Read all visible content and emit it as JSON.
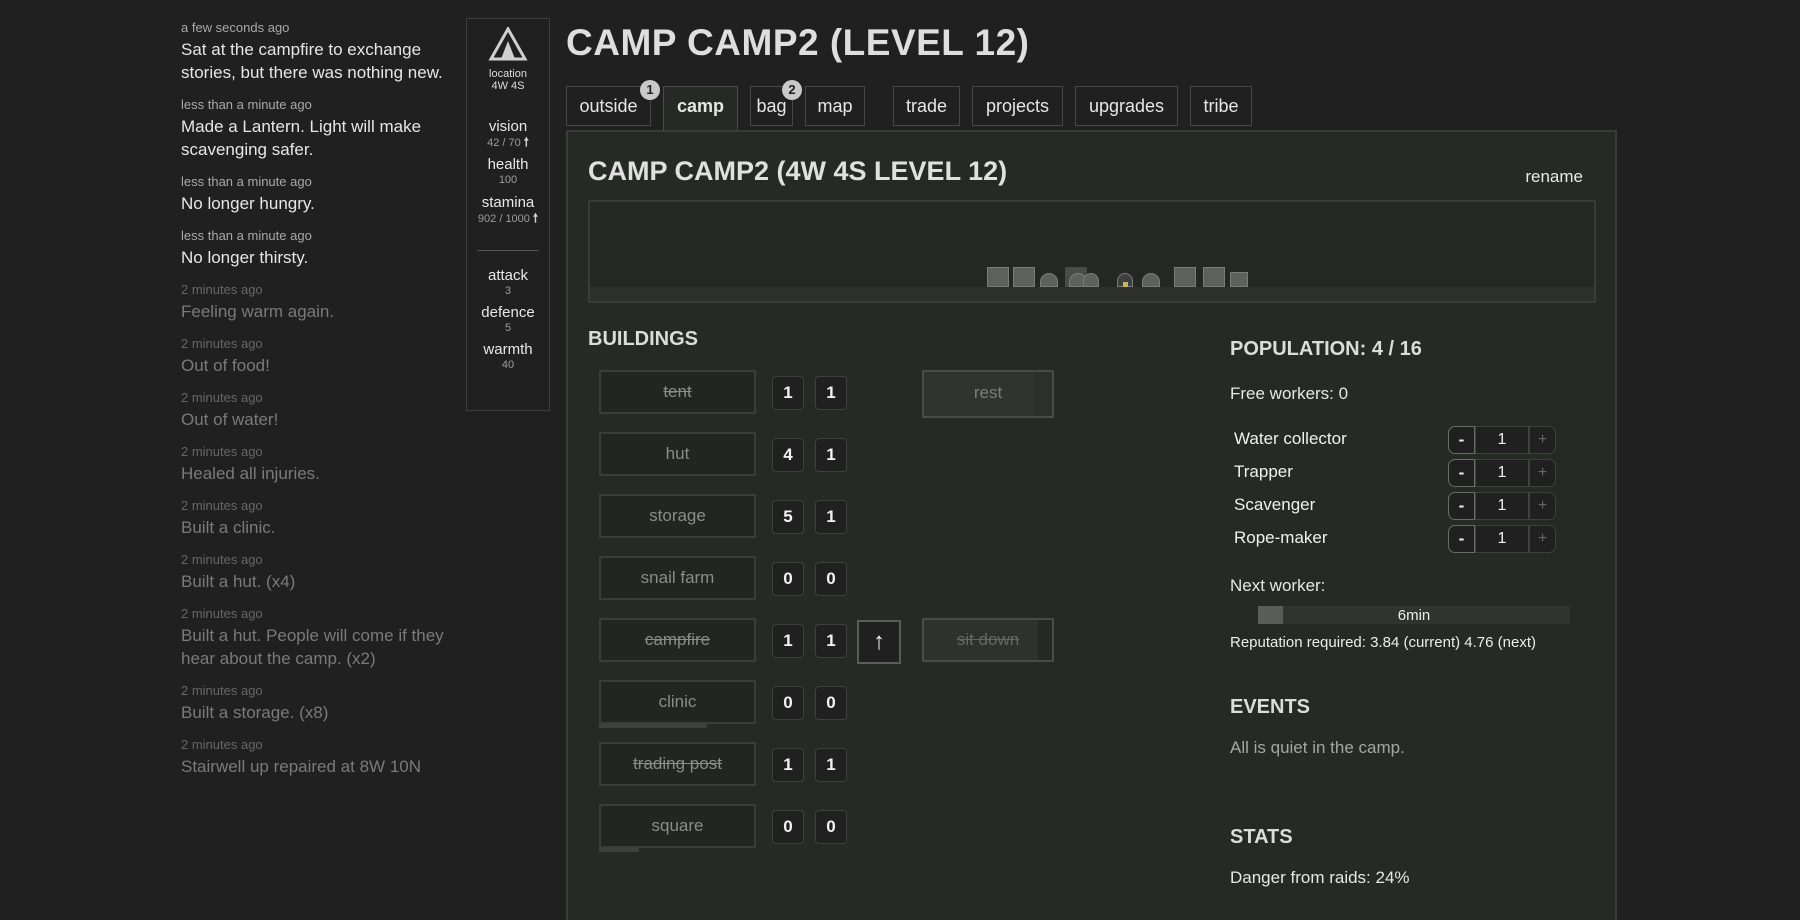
{
  "log": [
    {
      "time": "a few seconds ago",
      "text": "Sat at the campfire to exchange stories, but there was nothing new.",
      "faded": false
    },
    {
      "time": "less than a minute ago",
      "text": "Made a Lantern. Light will make scavenging safer.",
      "faded": false
    },
    {
      "time": "less than a minute ago",
      "text": "No longer hungry.",
      "faded": false
    },
    {
      "time": "less than a minute ago",
      "text": "No longer thirsty.",
      "faded": false
    },
    {
      "time": "2 minutes ago",
      "text": "Feeling warm again.",
      "faded": true
    },
    {
      "time": "2 minutes ago",
      "text": "Out of food!",
      "faded": true
    },
    {
      "time": "2 minutes ago",
      "text": "Out of water!",
      "faded": true
    },
    {
      "time": "2 minutes ago",
      "text": "Healed all injuries.",
      "faded": true
    },
    {
      "time": "2 minutes ago",
      "text": "Built a clinic.",
      "faded": true
    },
    {
      "time": "2 minutes ago",
      "text": "Built a hut. (x4)",
      "faded": true
    },
    {
      "time": "2 minutes ago",
      "text": "Built a hut. People will come if they hear about the camp. (x2)",
      "faded": true
    },
    {
      "time": "2 minutes ago",
      "text": "Built a storage. (x8)",
      "faded": true
    },
    {
      "time": "2 minutes ago",
      "text": "Stairwell up repaired at 8W 10N",
      "faded": true
    }
  ],
  "stats": {
    "icon": "tent-icon",
    "location_label": "location",
    "location_value": "4W 4S",
    "vision_label": "vision",
    "vision_value": "42 / 70",
    "health_label": "health",
    "health_value": "100",
    "stamina_label": "stamina",
    "stamina_value": "902 / 1000",
    "attack_label": "attack",
    "attack_value": "3",
    "defence_label": "defence",
    "defence_value": "5",
    "warmth_label": "warmth",
    "warmth_value": "40"
  },
  "page_title": "CAMP CAMP2 (LEVEL 12)",
  "tabs": [
    {
      "label": "outside",
      "badge": "1"
    },
    {
      "label": "camp",
      "badge": ""
    },
    {
      "label": "bag",
      "badge": "2"
    },
    {
      "label": "map",
      "badge": ""
    },
    {
      "label": "trade",
      "badge": ""
    },
    {
      "label": "projects",
      "badge": ""
    },
    {
      "label": "upgrades",
      "badge": ""
    },
    {
      "label": "tribe",
      "badge": ""
    }
  ],
  "camp": {
    "title": "CAMP CAMP2 (4W 4S LEVEL 12)",
    "rename_label": "rename",
    "buildings_heading": "BUILDINGS",
    "buildings": [
      {
        "name": "tent",
        "count": "1",
        "active": "1",
        "strike": true
      },
      {
        "name": "hut",
        "count": "4",
        "active": "1",
        "strike": false
      },
      {
        "name": "storage",
        "count": "5",
        "active": "1",
        "strike": false
      },
      {
        "name": "snail farm",
        "count": "0",
        "active": "0",
        "strike": false
      },
      {
        "name": "campfire",
        "count": "1",
        "active": "1",
        "strike": true
      },
      {
        "name": "clinic",
        "count": "0",
        "active": "0",
        "strike": false
      },
      {
        "name": "trading post",
        "count": "1",
        "active": "1",
        "strike": true
      },
      {
        "name": "square",
        "count": "0",
        "active": "0",
        "strike": false
      }
    ],
    "rest_label": "rest",
    "sit_down_label": "sit down",
    "upgrade_icon": "↑"
  },
  "population": {
    "title": "POPULATION: 4 / 16",
    "free_workers": "Free workers: 0",
    "workers": [
      {
        "name": "Water collector",
        "value": "1"
      },
      {
        "name": "Trapper",
        "value": "1"
      },
      {
        "name": "Scavenger",
        "value": "1"
      },
      {
        "name": "Rope-maker",
        "value": "1"
      }
    ],
    "minus_label": "-",
    "plus_label": "+",
    "next_worker_label": "Next worker:",
    "next_worker_time": "6min",
    "next_worker_progress": 0.08,
    "reputation": "Reputation required: 3.84 (current) 4.76 (next)"
  },
  "events": {
    "heading": "EVENTS",
    "text": "All is quiet in the camp."
  },
  "camp_stats": {
    "heading": "STATS",
    "danger": "Danger from raids: 24%"
  }
}
